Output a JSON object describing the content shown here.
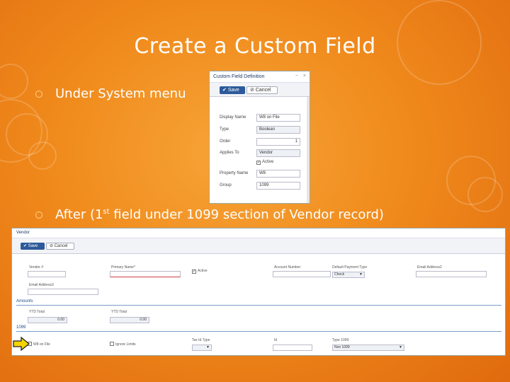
{
  "slide": {
    "title": "Create a Custom Field",
    "bullets": [
      {
        "text": "Under System menu"
      },
      {
        "text_before": "After (1",
        "sup": "st",
        "text_after": " field under 1099 section of Vendor record)"
      }
    ]
  },
  "dialog": {
    "title": "Custom Field Definition",
    "controls": [
      "−",
      "×"
    ],
    "save_label": "Save",
    "cancel_label": "Cancel",
    "fields": [
      {
        "label": "Display Name",
        "value": "W8 on File"
      },
      {
        "label": "Type",
        "value": "Boolean"
      },
      {
        "label": "Order",
        "value": "1"
      },
      {
        "label": "Applies To",
        "value": "Vendor"
      },
      {
        "label": "",
        "value": "Active"
      },
      {
        "label": "Property Name",
        "value": "W8"
      },
      {
        "label": "Group",
        "value": "1099"
      }
    ]
  },
  "vendor_form": {
    "title": "Vendor",
    "save_label": "Save",
    "cancel_label": "Cancel",
    "labels": {
      "vendor_no": "Vendor #",
      "primary_name": "Primary Name*",
      "active": "Active",
      "account_number": "Account Number",
      "default_payment_type": "Default Payment Type",
      "email_address2": "Email Address2",
      "email_address3": "Email Address3",
      "ytd_total_1": "YTD Total",
      "ytd_total_2": "YTD Total",
      "w8_on_file": "W8 on File",
      "ignore_limits": "Ignore Limits",
      "tax_id_type": "Tax Id Type",
      "id": "Id",
      "type_1099": "Type 1099"
    },
    "values": {
      "default_payment_type": "Check",
      "ytd_total_1": "0.00",
      "ytd_total_2": "0.00",
      "type_1099": "Non 1099"
    },
    "sections": {
      "amounts": "Amounts",
      "group_1099": "1099"
    }
  },
  "colors": {
    "accent": "#2d5a9a",
    "highlight_arrow": "#f5d400",
    "background": "#f08a1c"
  }
}
